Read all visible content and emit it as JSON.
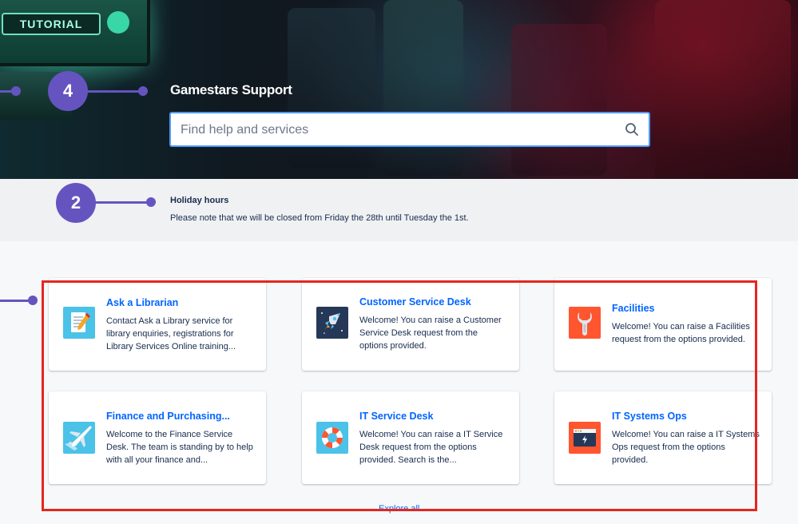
{
  "hero": {
    "portal_title": "Gamestars Support",
    "arcade_sign_text": "TUTORIAL"
  },
  "search": {
    "placeholder": "Find help and services",
    "icon": "search-icon"
  },
  "markers": {
    "help_center_marker": "4",
    "announcement_marker": "2",
    "color": "#6554c0"
  },
  "announcement": {
    "title": "Holiday hours",
    "text": "Please note that we will be closed from Friday the 28th until Tuesday the 1st."
  },
  "service_desks": [
    {
      "title": "Ask a Librarian",
      "description": "Contact Ask a Library service for library enquiries, registrations for Library Services Online training...",
      "icon": "notepad-pencil-icon"
    },
    {
      "title": "Customer Service Desk",
      "description": "Welcome! You can raise a Customer Service Desk request from the options provided.",
      "icon": "rocket-icon"
    },
    {
      "title": "Facilities",
      "description": "Welcome! You can raise a Facilities request from the options provided.",
      "icon": "wrench-icon"
    },
    {
      "title": "Finance and Purchasing...",
      "description": "Welcome to the Finance Service Desk. The team is standing by to help with all your finance and...",
      "icon": "airplane-icon"
    },
    {
      "title": "IT Service Desk",
      "description": "Welcome! You can raise a IT Service Desk request from the options provided. Search is the...",
      "icon": "lifebuoy-icon"
    },
    {
      "title": "IT Systems Ops",
      "description": "Welcome! You can raise a IT Systems Ops request from the options provided.",
      "icon": "browser-window-icon"
    }
  ],
  "explore_all_label": "Explore all",
  "colors": {
    "link": "#0065ff",
    "highlight_border": "#e5261f",
    "text": "#172b4d"
  }
}
